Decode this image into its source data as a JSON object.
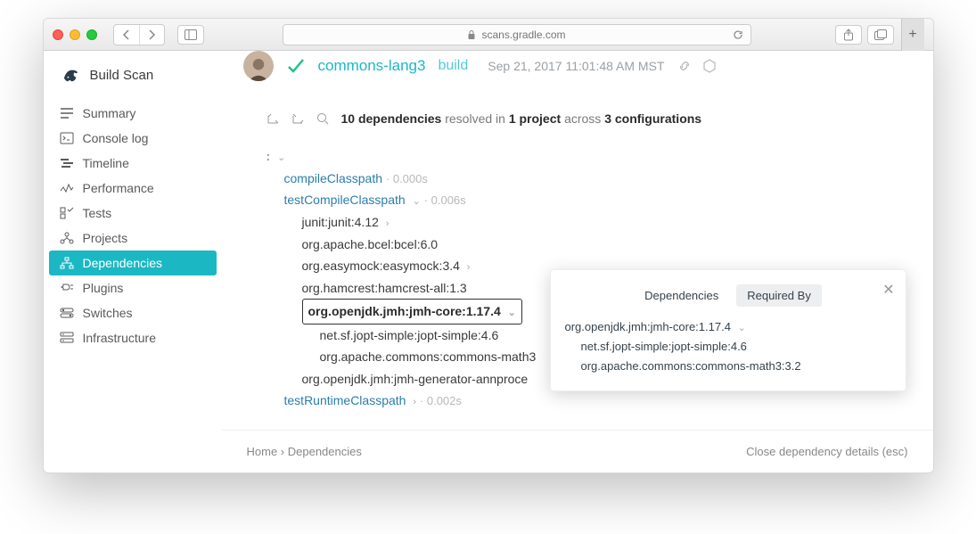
{
  "browser": {
    "address": "scans.gradle.com"
  },
  "brand": "Build Scan",
  "header": {
    "project": "commons-lang3",
    "task": "build",
    "timestamp": "Sep 21, 2017 11:01:48 AM MST"
  },
  "sidebar": {
    "items": [
      {
        "label": "Summary"
      },
      {
        "label": "Console log"
      },
      {
        "label": "Timeline"
      },
      {
        "label": "Performance"
      },
      {
        "label": "Tests"
      },
      {
        "label": "Projects"
      },
      {
        "label": "Dependencies"
      },
      {
        "label": "Plugins"
      },
      {
        "label": "Switches"
      },
      {
        "label": "Infrastructure"
      }
    ]
  },
  "summary": {
    "count": "10 dependencies",
    "resolved": "resolved in",
    "projects": "1 project",
    "across": "across",
    "configs": "3 configurations"
  },
  "tree": {
    "root": ":",
    "configs": [
      {
        "name": "compileClasspath",
        "time": "0.000s",
        "deps": []
      },
      {
        "name": "testCompileClasspath",
        "time": "0.006s",
        "deps": [
          {
            "name": "junit:junit:4.12",
            "expandable": true
          },
          {
            "name": "org.apache.bcel:bcel:6.0"
          },
          {
            "name": "org.easymock:easymock:3.4",
            "expandable": true
          },
          {
            "name": "org.hamcrest:hamcrest-all:1.3"
          },
          {
            "name": "org.openjdk.jmh:jmh-core:1.17.4",
            "selected": true,
            "expandable": true,
            "children": [
              {
                "name": "net.sf.jopt-simple:jopt-simple:4.6"
              },
              {
                "name": "org.apache.commons:commons-math3"
              }
            ]
          },
          {
            "name": "org.openjdk.jmh:jmh-generator-annproce"
          }
        ]
      },
      {
        "name": "testRuntimeClasspath",
        "time": "0.002s",
        "deps": []
      }
    ]
  },
  "popover": {
    "tabs": {
      "deps": "Dependencies",
      "req": "Required By"
    },
    "root": "org.openjdk.jmh:jmh-core:1.17.4",
    "children": [
      "net.sf.jopt-simple:jopt-simple:4.6",
      "org.apache.commons:commons-math3:3.2"
    ]
  },
  "footer": {
    "home": "Home",
    "crumb": "Dependencies",
    "close": "Close dependency details (esc)"
  }
}
